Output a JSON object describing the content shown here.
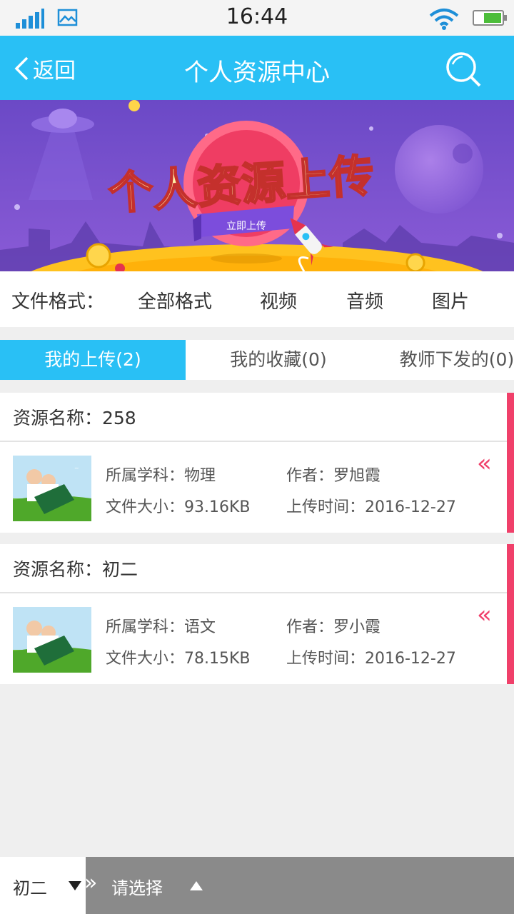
{
  "status_bar": {
    "time": "16:44",
    "icons": [
      "signal-icon",
      "image-icon",
      "wifi-icon",
      "battery-icon"
    ]
  },
  "header": {
    "back_label": "返回",
    "title": "个人资源中心",
    "search_icon": "search-icon"
  },
  "banner": {
    "headline": "个人资源上传",
    "button_label": "立即上传"
  },
  "formats": {
    "label": "文件格式：",
    "options": [
      "全部格式",
      "视频",
      "音频",
      "图片"
    ]
  },
  "tabs": [
    {
      "label": "我的上传(2)",
      "active": true
    },
    {
      "label": "我的收藏(0)",
      "active": false
    },
    {
      "label": "教师下发的(0)",
      "active": false
    }
  ],
  "resources": [
    {
      "name": "资源名称：258",
      "subject": "所属学科：物理",
      "author": "作者：罗旭霞",
      "size": "文件大小：93.16KB",
      "uploaded": "上传时间：2016-12-27"
    },
    {
      "name": "资源名称：初二",
      "subject": "所属学科：语文",
      "author": "作者：罗小霞",
      "size": "文件大小：78.15KB",
      "uploaded": "上传时间：2016-12-27"
    }
  ],
  "bottom_bar": {
    "grade_value": "初二",
    "select_placeholder": "请选择"
  },
  "colors": {
    "accent": "#29c0f5",
    "highlight": "#f0406a",
    "bottom_bar": "#8a8a8a"
  }
}
